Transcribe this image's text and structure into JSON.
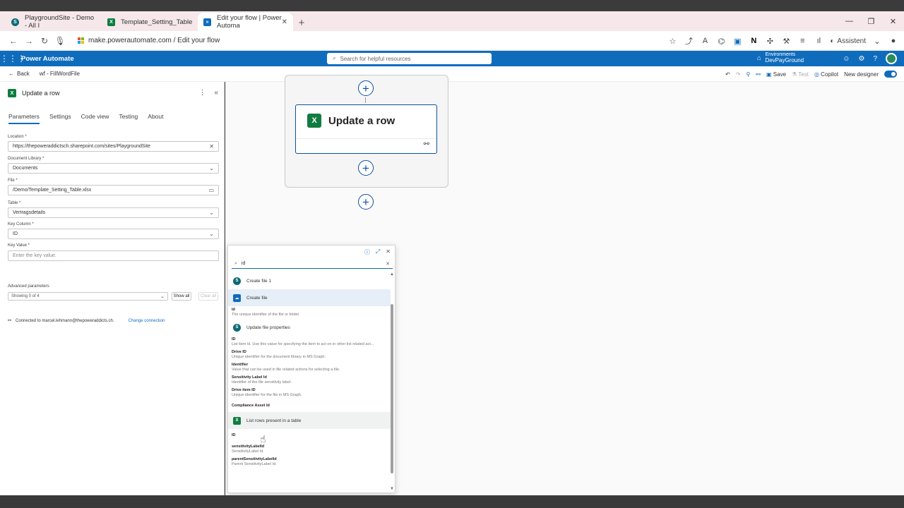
{
  "browser": {
    "tabs": [
      {
        "label": "PlaygroundSite - Demo - All I",
        "icon": "sharepoint-icon"
      },
      {
        "label": "Template_Setting_Table",
        "icon": "excel-icon"
      },
      {
        "label": "Edit your flow | Power Automa",
        "icon": "power-automate-icon"
      }
    ],
    "url": "make.powerautomate.com / Edit your flow",
    "assistant_label": "Assistent"
  },
  "app": {
    "name": "Power Automate",
    "search_placeholder": "Search for helpful resources",
    "env_label": "Environments",
    "env_name": "DevPayGround"
  },
  "cmdbar": {
    "back": "Back",
    "flow_name": "wf - FillWordFile",
    "save": "Save",
    "test": "Test",
    "copilot": "Copilot",
    "new_designer": "New designer"
  },
  "panel": {
    "title": "Update a row",
    "tabs": [
      "Parameters",
      "Settings",
      "Code view",
      "Testing",
      "About"
    ],
    "fields": {
      "location_label": "Location *",
      "location_value": "https://thepoweraddictsch.sharepoint.com/sites/PlaygroundSite",
      "library_label": "Document Library *",
      "library_value": "Documents",
      "file_label": "File *",
      "file_value": "/Demo/Template_Setting_Table.xlsx",
      "table_label": "Table *",
      "table_value": "Vertragsdetails",
      "keycol_label": "Key Column *",
      "keycol_value": "ID",
      "keyval_label": "Key Value *",
      "keyval_placeholder": "Enter the key value."
    },
    "advanced_label": "Advanced parameters",
    "advanced_value": "Showing 0 of 4",
    "show_all": "Show all",
    "clear_all": "Clear all",
    "connection": "Connected to marcel.lehmann@thepoweraddicts.ch.",
    "change_connection": "Change connection"
  },
  "canvas": {
    "card_title": "Update a row"
  },
  "popup": {
    "search_value": "id",
    "groups": [
      {
        "label": "Create file 1",
        "icon": "sp",
        "items": []
      },
      {
        "label": "Create file",
        "icon": "od",
        "items": [
          {
            "name": "Id",
            "desc": "The unique identifier of the file or folder."
          }
        ]
      },
      {
        "label": "Update file properties",
        "icon": "sp",
        "items": [
          {
            "name": "ID",
            "desc": "List item id. Use this value for specifying the item to act on in other list related act..."
          },
          {
            "name": "Drive ID",
            "desc": "Unique identifier for the document library in MS Graph."
          },
          {
            "name": "Identifier",
            "desc": "Value that can be used in file related actions for selecting a file."
          },
          {
            "name": "Sensitivity Label Id",
            "desc": "Identifier of the file sensitivity label."
          },
          {
            "name": "Drive item ID",
            "desc": "Unique identifier for the file in MS Graph."
          },
          {
            "name": "Compliance Asset Id",
            "desc": ""
          }
        ]
      },
      {
        "label": "List rows present in a table",
        "icon": "xl",
        "items": [
          {
            "name": "ID",
            "desc": ""
          },
          {
            "name": "sensitivityLabelId",
            "desc": "SensitivityLabel Id."
          },
          {
            "name": "parentSensitivityLabelId",
            "desc": "Parent SensitivityLabel Id."
          }
        ]
      }
    ]
  },
  "colors": {
    "brand": "#0f6cbd",
    "excel": "#107c41",
    "sharepoint": "#0b6a74"
  }
}
